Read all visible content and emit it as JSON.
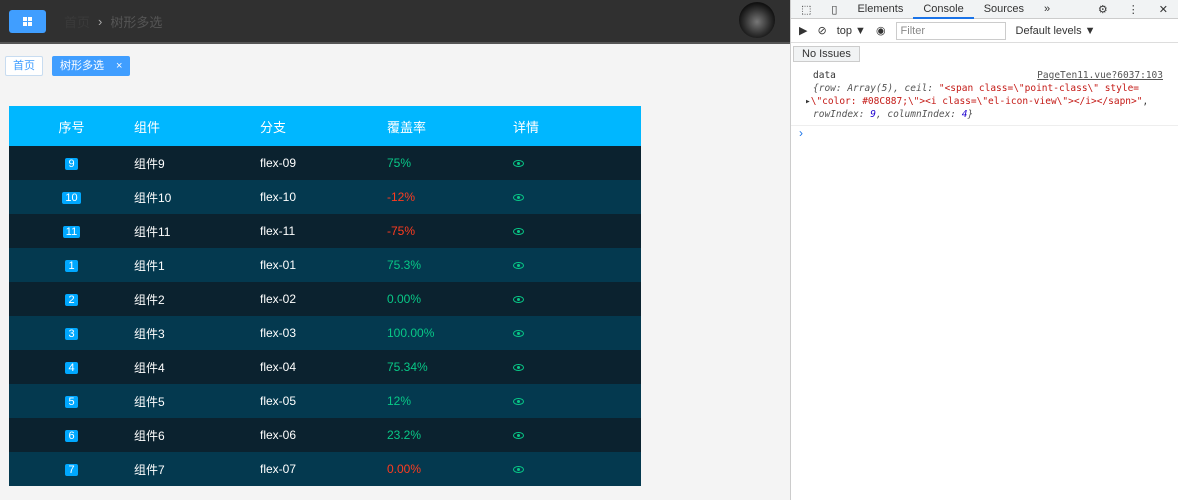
{
  "header": {
    "breadcrumb": [
      "首页",
      "树形多选"
    ]
  },
  "tags": [
    {
      "label": "首页"
    },
    {
      "label": "树形多选",
      "close": "×"
    }
  ],
  "table": {
    "columns": [
      "序号",
      "组件",
      "分支",
      "覆盖率",
      "详情"
    ],
    "rows": [
      {
        "index": "9",
        "name": "组件9",
        "branch": "flex-09",
        "rate": "75%",
        "status": "positive"
      },
      {
        "index": "10",
        "name": "组件10",
        "branch": "flex-10",
        "rate": "-12%",
        "status": "negative"
      },
      {
        "index": "11",
        "name": "组件11",
        "branch": "flex-11",
        "rate": "-75%",
        "status": "negative"
      },
      {
        "index": "1",
        "name": "组件1",
        "branch": "flex-01",
        "rate": "75.3%",
        "status": "positive"
      },
      {
        "index": "2",
        "name": "组件2",
        "branch": "flex-02",
        "rate": "0.00%",
        "status": "positive"
      },
      {
        "index": "3",
        "name": "组件3",
        "branch": "flex-03",
        "rate": "100.00%",
        "status": "positive"
      },
      {
        "index": "4",
        "name": "组件4",
        "branch": "flex-04",
        "rate": "75.34%",
        "status": "positive"
      },
      {
        "index": "5",
        "name": "组件5",
        "branch": "flex-05",
        "rate": "12%",
        "status": "positive"
      },
      {
        "index": "6",
        "name": "组件6",
        "branch": "flex-06",
        "rate": "23.2%",
        "status": "positive"
      },
      {
        "index": "7",
        "name": "组件7",
        "branch": "flex-07",
        "rate": "0.00%",
        "status": "negative"
      }
    ]
  },
  "devtools": {
    "tabs": [
      "Elements",
      "Console",
      "Sources",
      "»"
    ],
    "context": "top ▼",
    "filter_placeholder": "Filter",
    "levels": "Default levels ▼",
    "issues": "No Issues",
    "log": {
      "label": "data",
      "source": "PageTen11.vue?6037:103",
      "line1a": "{row: Array(5), ceil: ",
      "line1b": "\"<span class=\\\"point-class\\\" style=",
      "line2": "\\\"color: #08C887;\\\"><i class=\\\"el-icon-view\\\"></i></sapn>\"",
      "line3a": "rowIndex: ",
      "line3b": "9",
      "line3c": ", columnIndex: ",
      "line3d": "4",
      "line3e": "}"
    },
    "prompt": "›"
  },
  "colors": {
    "positive": "#08C887",
    "negative": "#FF3B1F",
    "header": "#00B7FF"
  }
}
